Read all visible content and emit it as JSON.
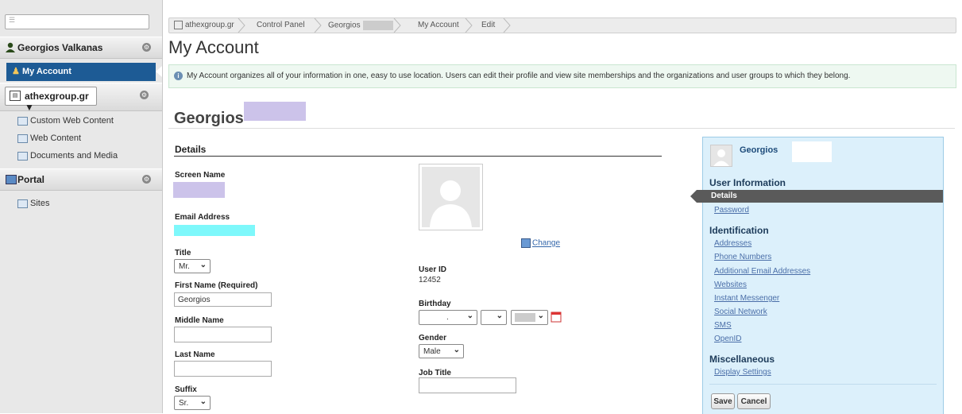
{
  "sidebar": {
    "search_placeholder": "",
    "user_name": "Georgios Valkanas",
    "my_account": "My Account",
    "site": "athexgroup.gr ▼",
    "site_items": [
      "Custom Web Content",
      "Web Content",
      "Documents and Media"
    ],
    "portal": "Portal",
    "portal_items": [
      "Sites"
    ]
  },
  "breadcrumb": [
    "athexgroup.gr",
    "Control Panel",
    "Georgios",
    "My Account",
    "Edit"
  ],
  "page_title": "My Account",
  "info_message": "My Account organizes all of your information in one, easy to use location. Users can edit their profile and view site memberships and the organizations and user groups to which they belong.",
  "user_heading": "Georgios",
  "details": {
    "section_title": "Details",
    "screen_name_label": "Screen Name",
    "email_label": "Email Address",
    "title_label": "Title",
    "title_value": "Mr.",
    "first_name_label": "First Name (Required)",
    "first_name_value": "Georgios",
    "middle_name_label": "Middle Name",
    "middle_name_value": "",
    "last_name_label": "Last Name",
    "last_name_value": "",
    "suffix_label": "Suffix",
    "suffix_value": "Sr.",
    "change_link": "Change",
    "user_id_label": "User ID",
    "user_id_value": "12452",
    "birthday_label": "Birthday",
    "birthday_month": ".",
    "birthday_day": "",
    "birthday_year": "",
    "gender_label": "Gender",
    "gender_value": "Male",
    "job_title_label": "Job Title",
    "job_title_value": ""
  },
  "right_panel": {
    "name": "Georgios",
    "user_info_heading": "User Information",
    "user_info_items": [
      "Details",
      "Password"
    ],
    "identification_heading": "Identification",
    "identification_items": [
      "Addresses",
      "Phone Numbers",
      "Additional Email Addresses",
      "Websites",
      "Instant Messenger",
      "Social Network",
      "SMS",
      "OpenID"
    ],
    "misc_heading": "Miscellaneous",
    "misc_items": [
      "Display Settings"
    ],
    "save_label": "Save",
    "cancel_label": "Cancel"
  },
  "colors": {
    "accent": "#1d5b95",
    "panel_bg": "#dcf0fb",
    "info_bg": "#eef8f1",
    "redaction_purple": "#ccc3ea",
    "redaction_cyan": "#7ef8fb"
  },
  "icons": {
    "search": "search-icon",
    "user": "user-icon",
    "gear": "gear-icon",
    "info": "info-icon",
    "calendar": "calendar-icon",
    "image": "image-icon"
  }
}
